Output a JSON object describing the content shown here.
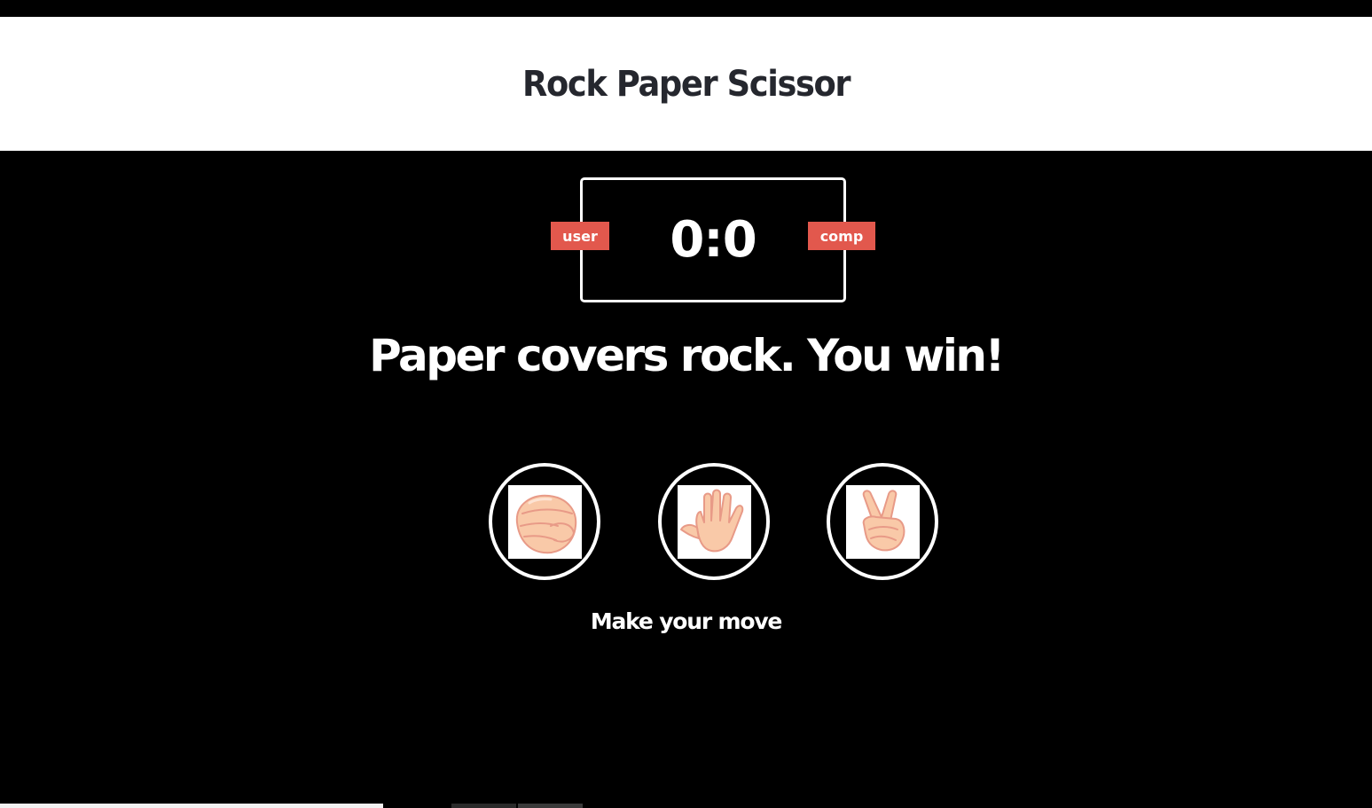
{
  "header": {
    "title": "Rock Paper Scissor"
  },
  "scoreboard": {
    "user_label": "user",
    "comp_label": "comp",
    "score": "0:0"
  },
  "result": {
    "message": "Paper covers rock. You win!"
  },
  "choices": [
    {
      "name": "rock",
      "icon": "rock-hand-icon"
    },
    {
      "name": "paper",
      "icon": "paper-hand-icon"
    },
    {
      "name": "scissors",
      "icon": "scissors-hand-icon"
    }
  ],
  "action_message": "Make your move",
  "colors": {
    "background": "#000000",
    "header_bg": "#ffffff",
    "title_text": "#25272e",
    "badge_bg": "#e2584d",
    "hand_fill": "#f9c9a8",
    "hand_stroke": "#e89a87"
  }
}
